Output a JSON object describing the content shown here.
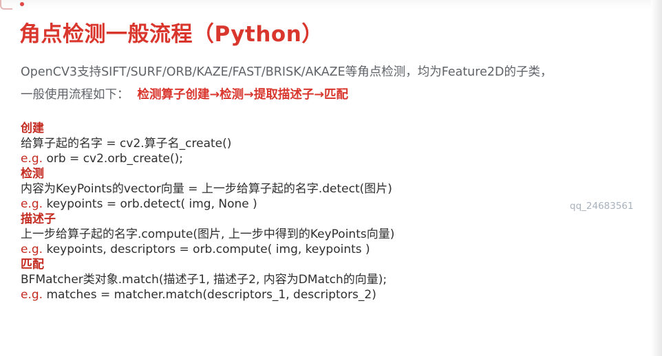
{
  "title": "角点检测一般流程（Python）",
  "intro": {
    "line1": "OpenCV3支持SIFT/SURF/ORB/KAZE/FAST/BRISK/AKAZE等角点检测，均为Feature2D的子类，",
    "line2_prefix": "一般使用流程如下：",
    "line2_emphasis": "检测算子创建→检测→提取描述子→匹配"
  },
  "sections": [
    {
      "heading": "创建",
      "line": "给算子起的名字 = cv2.算子名_create()",
      "example_prefix": "e.g.",
      "example": " orb = cv2.orb_create();"
    },
    {
      "heading": "检测",
      "line": "内容为KeyPoints的vector向量 = 上一步给算子起的名字.detect(图片)",
      "example_prefix": "e.g.",
      "example": " keypoints = orb.detect( img, None )"
    },
    {
      "heading": "描述子",
      "line": "上一步给算子起的名字.compute(图片, 上一步中得到的KeyPoints向量)",
      "example_prefix": "e.g.",
      "example": " keypoints, descriptors = orb.compute( img, keypoints )"
    },
    {
      "heading": "匹配",
      "line": "BFMatcher类对象.match(描述子1, 描述子2, 内容为DMatch的向量);",
      "example_prefix": "e.g.",
      "example": " matches = matcher.match(descriptors_1, descriptors_2)"
    }
  ],
  "watermark": "qq_24683561"
}
